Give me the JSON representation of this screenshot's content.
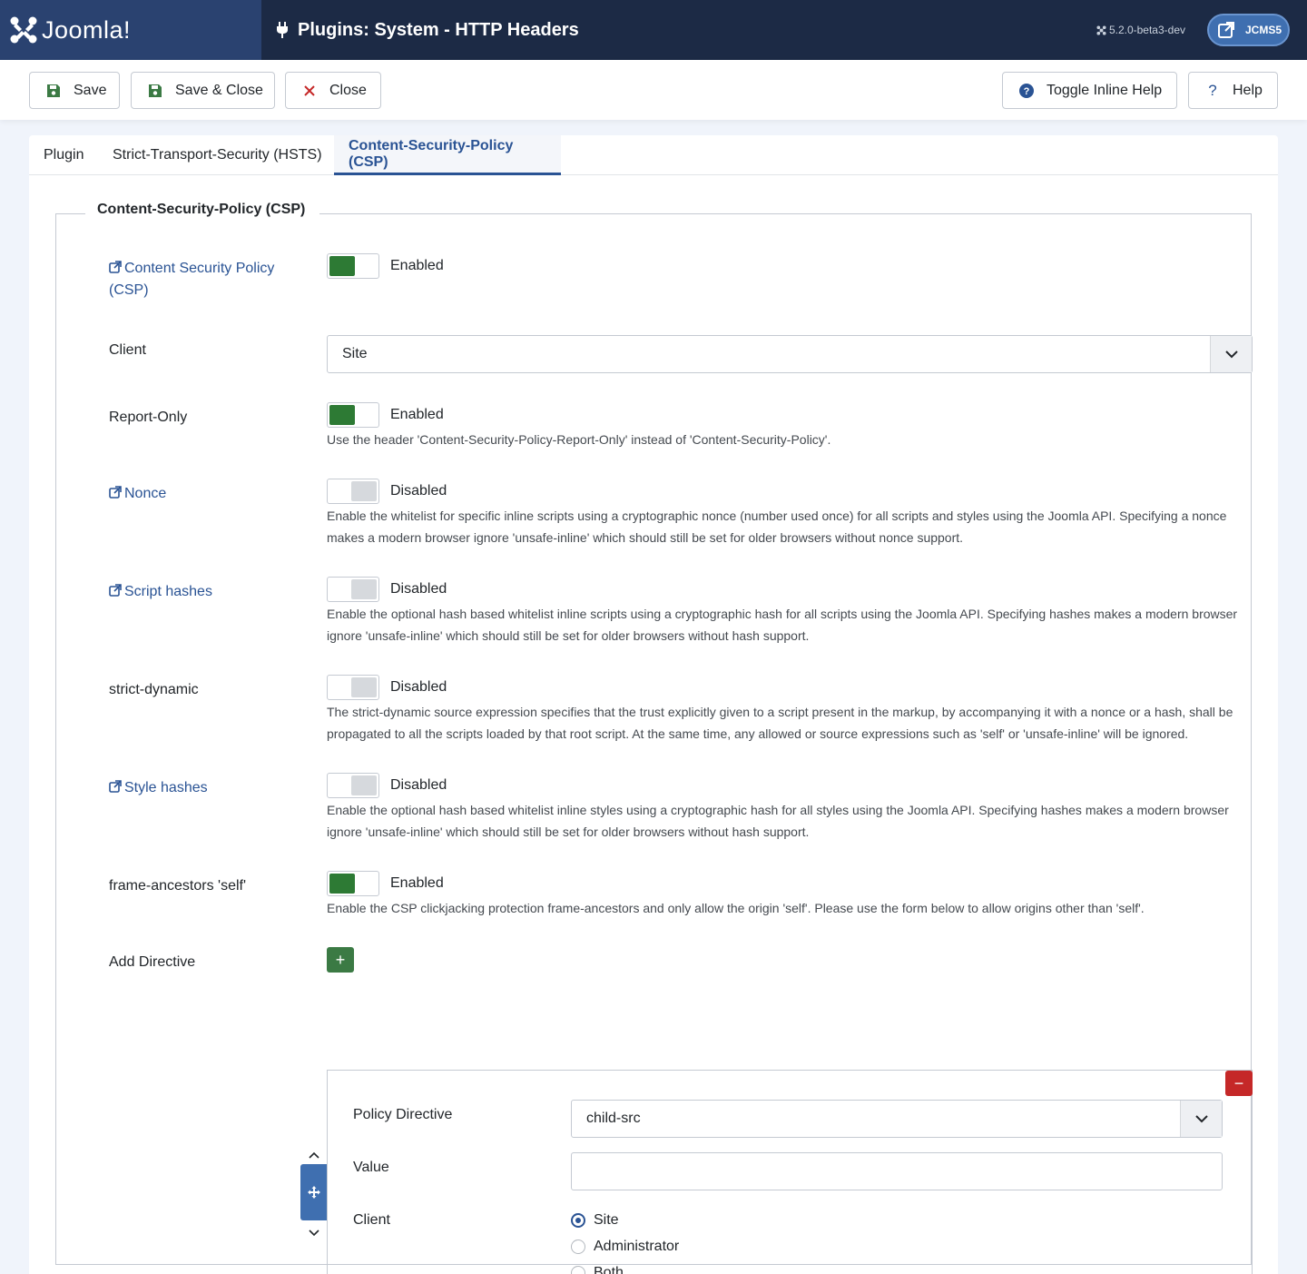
{
  "header": {
    "logo_text": "Joomla!",
    "page_title": "Plugins: System - HTTP Headers",
    "version": "5.2.0-beta3-dev",
    "site_button_label": "JCMS5"
  },
  "toolbar": {
    "save_label": "Save",
    "save_close_label": "Save & Close",
    "close_label": "Close",
    "toggle_help_label": "Toggle Inline Help",
    "help_label": "Help"
  },
  "tabs": [
    {
      "label": "Plugin"
    },
    {
      "label": "Strict-Transport-Security (HSTS)"
    },
    {
      "label": "Content-Security-Policy (CSP)"
    }
  ],
  "fieldset": {
    "legend": "Content-Security-Policy (CSP)"
  },
  "fields": {
    "csp": {
      "label_line1": "Content Security Policy",
      "label_line2": "(CSP)",
      "state": "Enabled"
    },
    "client": {
      "label": "Client",
      "value": "Site"
    },
    "report_only": {
      "label": "Report-Only",
      "state": "Enabled",
      "desc": "Use the header 'Content-Security-Policy-Report-Only' instead of 'Content-Security-Policy'."
    },
    "nonce": {
      "label": "Nonce",
      "state": "Disabled",
      "desc_line1": "Enable the whitelist for specific inline scripts using a cryptographic nonce (number used once) for all scripts and styles using the Joomla API. Specifying a nonce",
      "desc_line2": "makes a modern browser ignore 'unsafe-inline' which should still be set for older browsers without nonce support."
    },
    "script_hashes": {
      "label": "Script hashes",
      "state": "Disabled",
      "desc_line1": "Enable the optional hash based whitelist inline scripts using a cryptographic hash for all scripts using the Joomla API. Specifying hashes makes a modern browser",
      "desc_line2": "ignore 'unsafe-inline' which should still be set for older browsers without hash support."
    },
    "strict_dynamic": {
      "label": "strict-dynamic",
      "state": "Disabled",
      "desc_line1": "The strict-dynamic source expression specifies that the trust explicitly given to a script present in the markup, by accompanying it with a nonce or a hash, shall be",
      "desc_line2": "propagated to all the scripts loaded by that root script. At the same time, any allowed or source expressions such as 'self' or 'unsafe-inline' will be ignored."
    },
    "style_hashes": {
      "label": "Style hashes",
      "state": "Disabled",
      "desc_line1": "Enable the optional hash based whitelist inline styles using a cryptographic hash for all styles using the Joomla API. Specifying hashes makes a modern browser",
      "desc_line2": "ignore 'unsafe-inline' which should still be set for older browsers without hash support."
    },
    "frame_ancestors": {
      "label": "frame-ancestors 'self'",
      "state": "Enabled",
      "desc": "Enable the CSP clickjacking protection frame-ancestors and only allow the origin 'self'. Please use the form below to allow origins other than 'self'."
    },
    "add_directive": {
      "label": "Add Directive"
    }
  },
  "subform": {
    "policy_directive_label": "Policy Directive",
    "policy_directive_value": "child-src",
    "value_label": "Value",
    "value_value": "",
    "client_label": "Client",
    "client_options": [
      "Site",
      "Administrator",
      "Both"
    ],
    "client_selected": "Site"
  },
  "colors": {
    "header_bg": "#1c2a45",
    "logo_bg": "#2a4270",
    "accent": "#2a5394",
    "switch_on": "#2d7a34",
    "add_button": "#3b7a44",
    "remove_button": "#c52828"
  }
}
